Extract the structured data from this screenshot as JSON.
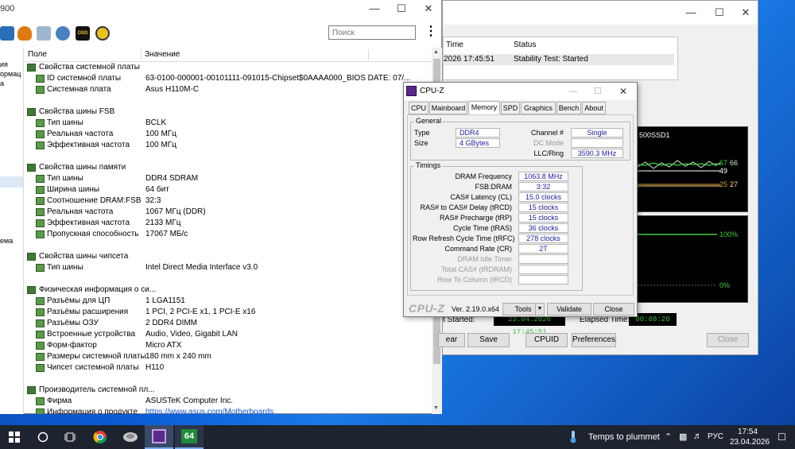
{
  "aida": {
    "title": "900",
    "search_placeholder": "Поиск",
    "kebab": "⋮",
    "col_field": "Поле",
    "col_value": "Значение",
    "left_strip": [
      "ия",
      "ормац",
      "а",
      "ема"
    ],
    "rows": [
      {
        "type": "section",
        "label": "Свойства системной платы",
        "value": ""
      },
      {
        "type": "item",
        "label": "ID системной платы",
        "value": "63-0100-000001-00101111-091015-Chipset$0AAAA000_BIOS DATE: 07/..."
      },
      {
        "type": "item",
        "label": "Системная плата",
        "value": "Asus H110M-C"
      },
      {
        "type": "gap"
      },
      {
        "type": "section",
        "label": "Свойства шины FSB",
        "value": ""
      },
      {
        "type": "item",
        "label": "Тип шины",
        "value": "BCLK"
      },
      {
        "type": "item",
        "label": "Реальная частота",
        "value": "100 МГц"
      },
      {
        "type": "item",
        "label": "Эффективная частота",
        "value": "100 МГц"
      },
      {
        "type": "gap"
      },
      {
        "type": "section",
        "label": "Свойства шины памяти",
        "value": ""
      },
      {
        "type": "item",
        "label": "Тип шины",
        "value": "DDR4 SDRAM"
      },
      {
        "type": "item",
        "label": "Ширина шины",
        "value": "64 бит"
      },
      {
        "type": "item",
        "label": "Соотношение DRAM:FSB",
        "value": "32:3"
      },
      {
        "type": "item",
        "label": "Реальная частота",
        "value": "1067 МГц (DDR)"
      },
      {
        "type": "item",
        "label": "Эффективная частота",
        "value": "2133 МГц"
      },
      {
        "type": "item",
        "label": "Пропускная способность",
        "value": "17067 МБ/с"
      },
      {
        "type": "gap"
      },
      {
        "type": "section",
        "label": "Свойства шины чипсета",
        "value": ""
      },
      {
        "type": "item",
        "label": "Тип шины",
        "value": "Intel Direct Media Interface v3.0"
      },
      {
        "type": "gap"
      },
      {
        "type": "section",
        "label": "Физическая информация о си...",
        "value": ""
      },
      {
        "type": "item",
        "label": "Разъёмы для ЦП",
        "value": "1 LGA1151"
      },
      {
        "type": "item",
        "label": "Разъёмы расширения",
        "value": "1 PCI, 2 PCI-E x1, 1 PCI-E x16"
      },
      {
        "type": "item",
        "label": "Разъёмы ОЗУ",
        "value": "2 DDR4 DIMM"
      },
      {
        "type": "item",
        "label": "Встроенные устройства",
        "value": "Audio, Video, Gigabit LAN"
      },
      {
        "type": "item",
        "label": "Форм-фактор",
        "value": "Micro ATX"
      },
      {
        "type": "item",
        "label": "Размеры системной платы",
        "value": "180 mm x 240 mm"
      },
      {
        "type": "item",
        "label": "Чипсет системной платы",
        "value": "H110"
      },
      {
        "type": "gap"
      },
      {
        "type": "section",
        "label": "Производитель системной пл...",
        "value": ""
      },
      {
        "type": "item",
        "label": "Фирма",
        "value": "ASUSTeK Computer Inc."
      },
      {
        "type": "item",
        "label": "Информация о продукте",
        "value": "https://www.asus.com/Motherboards",
        "link": true
      }
    ]
  },
  "stability": {
    "col_time": "Time",
    "col_status": "Status",
    "log_time": "2026 17:45:51",
    "log_status": "Stability Test: Started",
    "graph1_title": "500SSD1",
    "graph1_labels": {
      "a": "67",
      "b": "66",
      "c": "49",
      "d": "25",
      "e": "27"
    },
    "graph2_labels": {
      "top": "100%",
      "bottom": "0%"
    },
    "started_label": "t Started:",
    "started_value": "23.04.2026 17:45:51",
    "elapsed_label": "Elapsed Time:",
    "elapsed_value": "00:08:20",
    "buttons": {
      "clear": "ear",
      "save": "Save",
      "cpuid": "CPUID",
      "preferences": "Preferences",
      "close": "Close"
    }
  },
  "cpuz": {
    "title": "CPU-Z",
    "tabs": [
      "CPU",
      "Mainboard",
      "Memory",
      "SPD",
      "Graphics",
      "Bench",
      "About"
    ],
    "active_tab": "Memory",
    "general_title": "General",
    "type_label": "Type",
    "type_value": "DDR4",
    "size_label": "Size",
    "size_value": "4 GBytes",
    "channel_label": "Channel #",
    "channel_value": "Single",
    "dcmode_label": "DC Mode",
    "dcmode_value": "",
    "llc_label": "LLC/Ring",
    "llc_value": "3590.3 MHz",
    "timings_title": "Timings",
    "timings": [
      {
        "label": "DRAM Frequency",
        "value": "1063.8 MHz",
        "disabled": false
      },
      {
        "label": "FSB:DRAM",
        "value": "3:32",
        "disabled": false
      },
      {
        "label": "CAS# Latency (CL)",
        "value": "15.0 clocks",
        "disabled": false
      },
      {
        "label": "RAS# to CAS# Delay (tRCD)",
        "value": "15 clocks",
        "disabled": false
      },
      {
        "label": "RAS# Precharge (tRP)",
        "value": "15 clocks",
        "disabled": false
      },
      {
        "label": "Cycle Time (tRAS)",
        "value": "36 clocks",
        "disabled": false
      },
      {
        "label": "Row Refresh Cycle Time (tRFC)",
        "value": "278 clocks",
        "disabled": false
      },
      {
        "label": "Command Rate (CR)",
        "value": "2T",
        "disabled": false
      },
      {
        "label": "DRAM Idle Timer",
        "value": "",
        "disabled": true
      },
      {
        "label": "Total CAS# (tRDRAM)",
        "value": "",
        "disabled": true
      },
      {
        "label": "Row To Column (tRCD)",
        "value": "",
        "disabled": true
      }
    ],
    "brand": "CPU-Z",
    "version": "Ver. 2.19.0.x64",
    "tools_label": "Tools",
    "validate_label": "Validate",
    "close_label": "Close"
  },
  "taskbar": {
    "weather_text": "Temps to plummet",
    "lang": "РУС",
    "time": "17:54",
    "date": "23.04.2026",
    "aida_label": "64"
  }
}
